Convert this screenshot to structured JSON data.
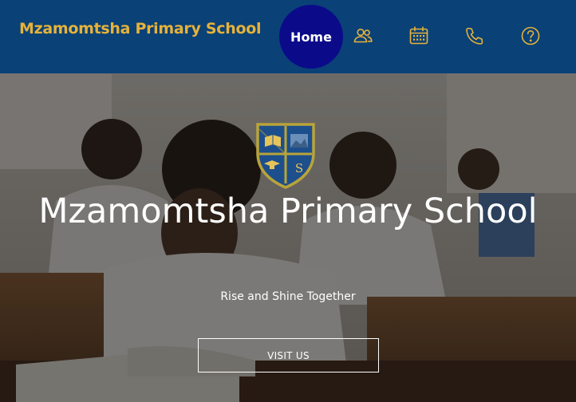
{
  "header": {
    "brand": "Mzamomtsha Primary School",
    "nav": {
      "home_label": "Home",
      "icons": [
        "users-icon",
        "calendar-icon",
        "phone-icon",
        "help-icon"
      ]
    }
  },
  "hero": {
    "title": "Mzamomtsha Primary School",
    "tagline": "Rise and Shine Together",
    "cta_label": "VISIT US"
  },
  "colors": {
    "navbar_bg": "#0a4177",
    "brand_gold": "#e6b23a",
    "home_active_bg": "#0b0b8a",
    "crest_blue": "#1d4f8c",
    "crest_border": "#b9a43a"
  }
}
